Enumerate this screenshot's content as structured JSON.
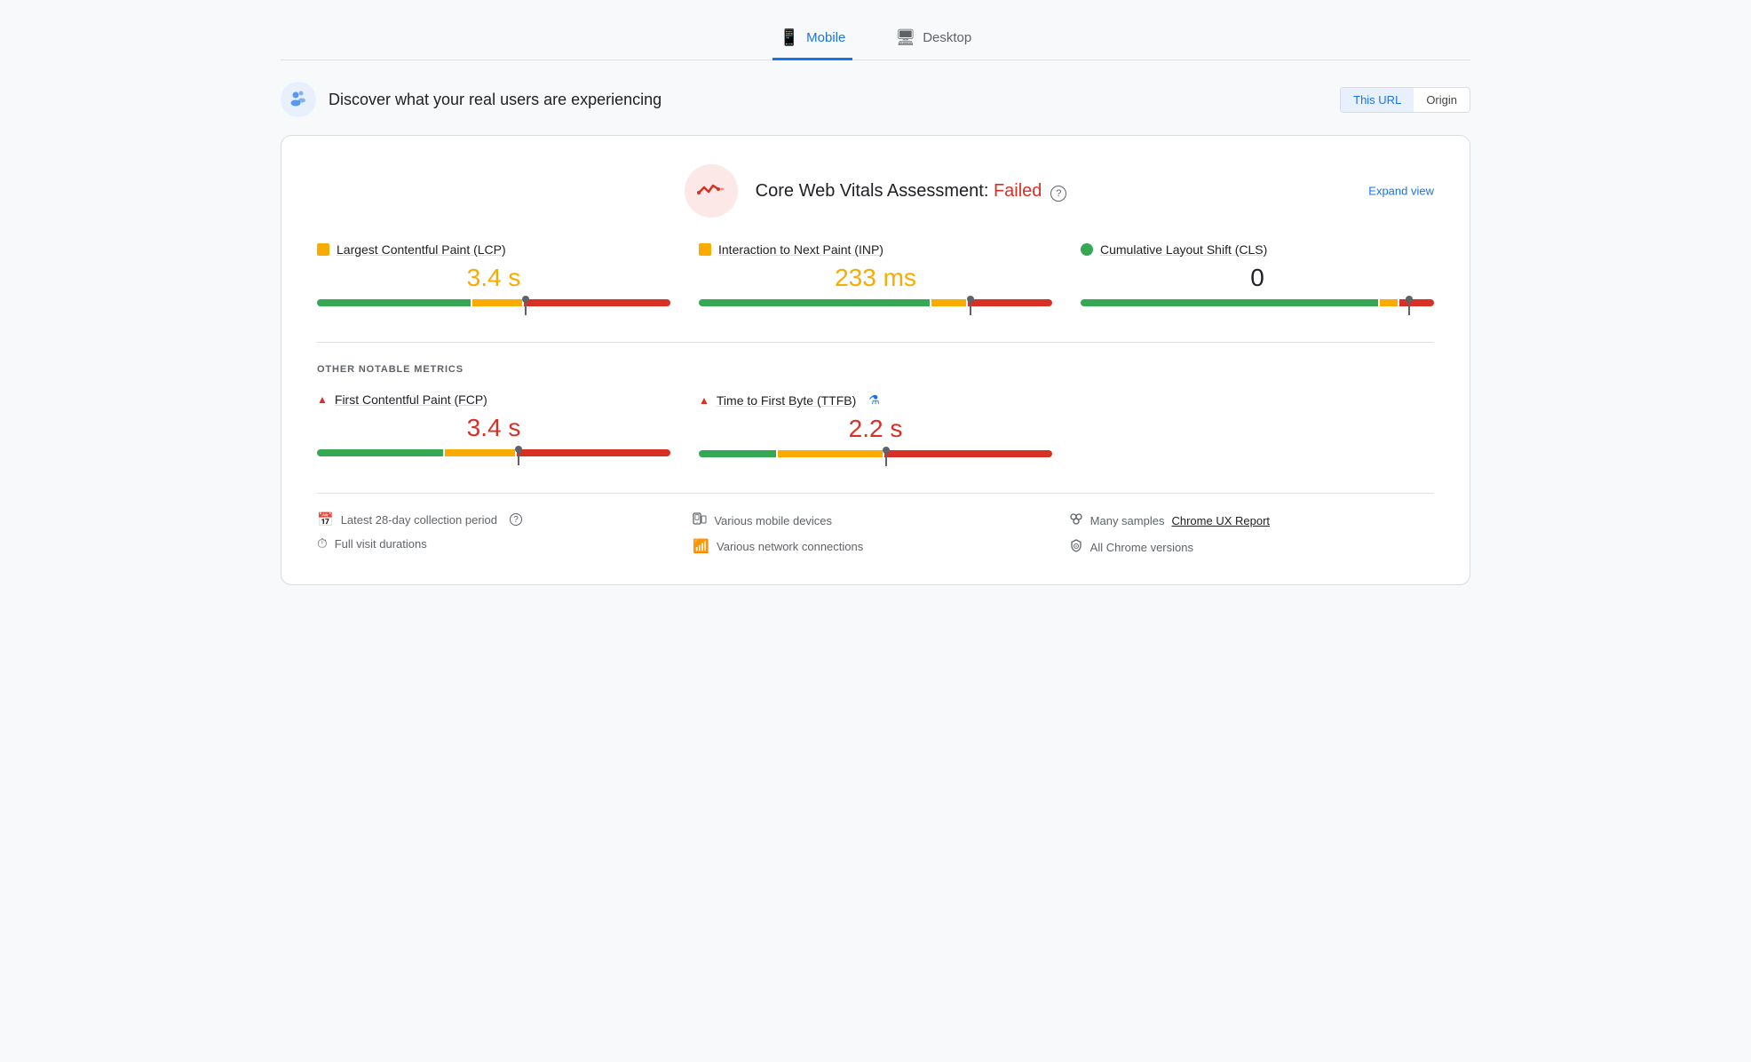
{
  "tabs": [
    {
      "id": "mobile",
      "label": "Mobile",
      "icon": "📱",
      "active": true
    },
    {
      "id": "desktop",
      "label": "Desktop",
      "icon": "🖥",
      "active": false
    }
  ],
  "header": {
    "title": "Discover what your real users are experiencing",
    "url_toggle": {
      "this_url": "This URL",
      "origin": "Origin"
    }
  },
  "assessment": {
    "title_prefix": "Core Web Vitals Assessment: ",
    "status": "Failed",
    "expand_label": "Expand view"
  },
  "core_metrics": [
    {
      "id": "lcp",
      "label": "Largest Contentful Paint (LCP)",
      "dot_type": "square",
      "dot_color": "orange",
      "value": "3.4 s",
      "value_color": "orange",
      "bar": {
        "green_pct": 44,
        "orange_pct": 14,
        "red_pct": 42,
        "marker_pct": 58
      }
    },
    {
      "id": "inp",
      "label": "Interaction to Next Paint (INP)",
      "dot_type": "square",
      "dot_color": "orange",
      "value": "233 ms",
      "value_color": "orange",
      "bar": {
        "green_pct": 66,
        "orange_pct": 10,
        "red_pct": 24,
        "marker_pct": 76
      }
    },
    {
      "id": "cls",
      "label": "Cumulative Layout Shift (CLS)",
      "dot_type": "circle",
      "dot_color": "green",
      "value": "0",
      "value_color": "black",
      "bar": {
        "green_pct": 85,
        "orange_pct": 5,
        "red_pct": 10,
        "marker_pct": 92
      }
    }
  ],
  "other_metrics_label": "OTHER NOTABLE METRICS",
  "other_metrics": [
    {
      "id": "fcp",
      "label": "First Contentful Paint (FCP)",
      "icon_type": "triangle",
      "icon_color": "red",
      "value": "3.4 s",
      "value_color": "red",
      "bar": {
        "green_pct": 36,
        "orange_pct": 20,
        "red_pct": 44,
        "marker_pct": 56
      }
    },
    {
      "id": "ttfb",
      "label": "Time to First Byte (TTFB)",
      "icon_type": "triangle",
      "icon_color": "red",
      "extra_icon": "flask",
      "value": "2.2 s",
      "value_color": "red",
      "bar": {
        "green_pct": 22,
        "orange_pct": 30,
        "red_pct": 48,
        "marker_pct": 52
      }
    },
    {
      "id": "empty",
      "label": "",
      "value": ""
    }
  ],
  "footer": {
    "col1": [
      {
        "icon": "📅",
        "text": "Latest 28-day collection period",
        "has_help": true
      },
      {
        "icon": "⏱",
        "text": "Full visit durations"
      }
    ],
    "col2": [
      {
        "icon": "📱",
        "text": "Various mobile devices"
      },
      {
        "icon": "📶",
        "text": "Various network connections"
      }
    ],
    "col3": [
      {
        "icon": "👥",
        "text_before": "Many samples ",
        "link_text": "Chrome UX Report",
        "text_after": ""
      },
      {
        "icon": "🛡",
        "text": "All Chrome versions"
      }
    ]
  }
}
